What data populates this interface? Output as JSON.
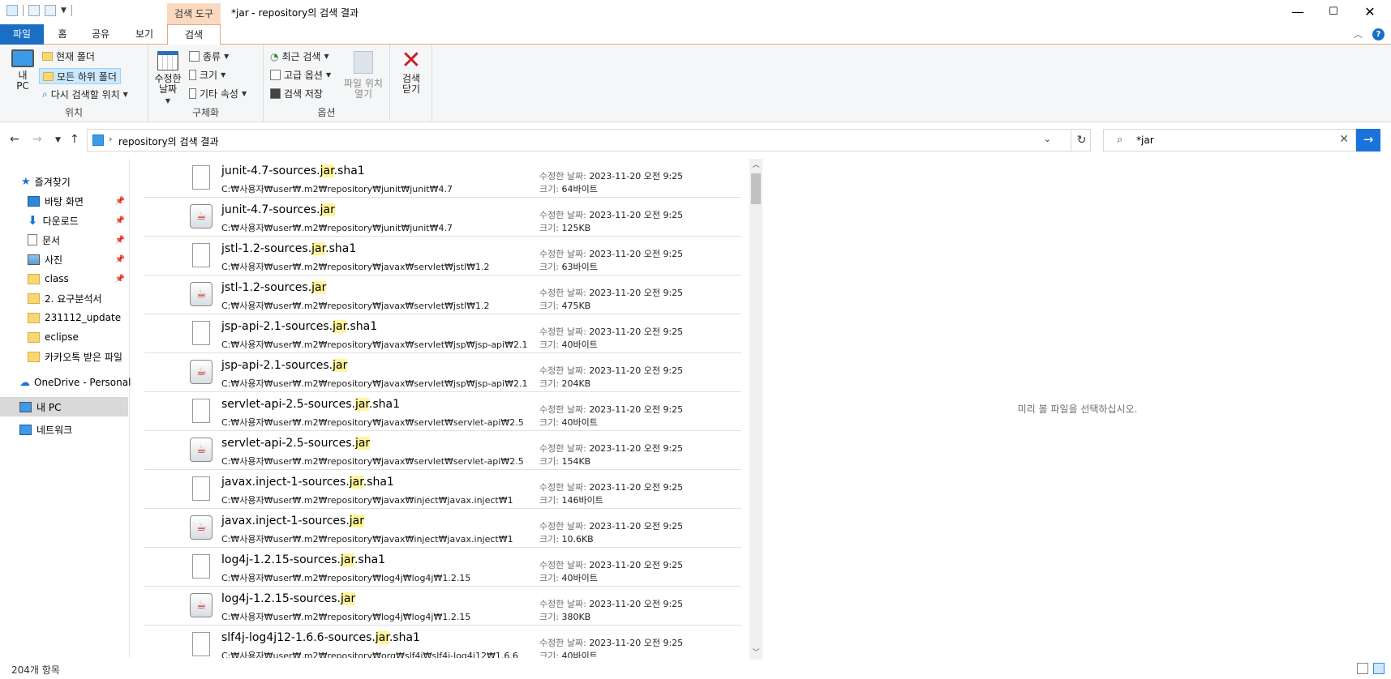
{
  "window": {
    "title": "*jar - repository의 검색 결과",
    "search_tools_tab": "검색 도구",
    "minimize": "—",
    "maximize": "☐",
    "close": "✕"
  },
  "ribbon": {
    "tabs": [
      "파일",
      "홈",
      "공유",
      "보기",
      "검색"
    ],
    "active_tab": "검색",
    "location_group": {
      "label": "위치",
      "this_pc": "내 PC",
      "current_folder": "현재 폴더",
      "all_subfolders": "모든 하위 폴더",
      "search_again": "다시 검색할 위치"
    },
    "refine_group": {
      "label": "구체화",
      "date_modified": "수정한 날짜",
      "kind": "종류",
      "size": "크기",
      "other_props": "기타 속성"
    },
    "options_group": {
      "label": "옵션",
      "recent_searches": "최근 검색",
      "advanced_options": "고급 옵션",
      "save_search": "검색 저장",
      "open_file_location": "파일 위치 열기"
    },
    "close_search": "검색 닫기"
  },
  "address": {
    "path": "repository의 검색 결과",
    "search_value": "*jar"
  },
  "nav": {
    "quick_access": "즐겨찾기",
    "items": [
      {
        "label": "바탕 화면",
        "pinned": true,
        "icon": "desktop-icon"
      },
      {
        "label": "다운로드",
        "pinned": true,
        "icon": "download-icon"
      },
      {
        "label": "문서",
        "pinned": true,
        "icon": "document-icon"
      },
      {
        "label": "사진",
        "pinned": true,
        "icon": "picture-icon"
      },
      {
        "label": "class",
        "pinned": true,
        "icon": "folder-icon"
      },
      {
        "label": "2. 요구분석서",
        "pinned": false,
        "icon": "folder-icon"
      },
      {
        "label": "231112_update",
        "pinned": false,
        "icon": "folder-icon"
      },
      {
        "label": "eclipse",
        "pinned": false,
        "icon": "folder-icon"
      },
      {
        "label": "카카오톡 받은 파일",
        "pinned": false,
        "icon": "folder-icon"
      }
    ],
    "onedrive": "OneDrive - Personal",
    "this_pc": "내 PC",
    "network": "네트워크"
  },
  "files": [
    {
      "pre": "junit-4.7-sources.",
      "hl": "jar",
      "post": ".sha1",
      "type": "doc",
      "path": "C:₩사용자₩user₩.m2₩repository₩junit₩junit₩4.7",
      "date": "2023-11-20 오전 9:25",
      "size": "64바이트"
    },
    {
      "pre": "junit-4.7-sources.",
      "hl": "jar",
      "post": "",
      "type": "java",
      "path": "C:₩사용자₩user₩.m2₩repository₩junit₩junit₩4.7",
      "date": "2023-11-20 오전 9:25",
      "size": "125KB"
    },
    {
      "pre": "jstl-1.2-sources.",
      "hl": "jar",
      "post": ".sha1",
      "type": "doc",
      "path": "C:₩사용자₩user₩.m2₩repository₩javax₩servlet₩jstl₩1.2",
      "date": "2023-11-20 오전 9:25",
      "size": "63바이트"
    },
    {
      "pre": "jstl-1.2-sources.",
      "hl": "jar",
      "post": "",
      "type": "java",
      "path": "C:₩사용자₩user₩.m2₩repository₩javax₩servlet₩jstl₩1.2",
      "date": "2023-11-20 오전 9:25",
      "size": "475KB"
    },
    {
      "pre": "jsp-api-2.1-sources.",
      "hl": "jar",
      "post": ".sha1",
      "type": "doc",
      "path": "C:₩사용자₩user₩.m2₩repository₩javax₩servlet₩jsp₩jsp-api₩2.1",
      "date": "2023-11-20 오전 9:25",
      "size": "40바이트"
    },
    {
      "pre": "jsp-api-2.1-sources.",
      "hl": "jar",
      "post": "",
      "type": "java",
      "path": "C:₩사용자₩user₩.m2₩repository₩javax₩servlet₩jsp₩jsp-api₩2.1",
      "date": "2023-11-20 오전 9:25",
      "size": "204KB"
    },
    {
      "pre": "servlet-api-2.5-sources.",
      "hl": "jar",
      "post": ".sha1",
      "type": "doc",
      "path": "C:₩사용자₩user₩.m2₩repository₩javax₩servlet₩servlet-api₩2.5",
      "date": "2023-11-20 오전 9:25",
      "size": "40바이트"
    },
    {
      "pre": "servlet-api-2.5-sources.",
      "hl": "jar",
      "post": "",
      "type": "java",
      "path": "C:₩사용자₩user₩.m2₩repository₩javax₩servlet₩servlet-api₩2.5",
      "date": "2023-11-20 오전 9:25",
      "size": "154KB"
    },
    {
      "pre": "javax.inject-1-sources.",
      "hl": "jar",
      "post": ".sha1",
      "type": "doc",
      "path": "C:₩사용자₩user₩.m2₩repository₩javax₩inject₩javax.inject₩1",
      "date": "2023-11-20 오전 9:25",
      "size": "146바이트"
    },
    {
      "pre": "javax.inject-1-sources.",
      "hl": "jar",
      "post": "",
      "type": "java",
      "path": "C:₩사용자₩user₩.m2₩repository₩javax₩inject₩javax.inject₩1",
      "date": "2023-11-20 오전 9:25",
      "size": "10.6KB"
    },
    {
      "pre": "log4j-1.2.15-sources.",
      "hl": "jar",
      "post": ".sha1",
      "type": "doc",
      "path": "C:₩사용자₩user₩.m2₩repository₩log4j₩log4j₩1.2.15",
      "date": "2023-11-20 오전 9:25",
      "size": "40바이트"
    },
    {
      "pre": "log4j-1.2.15-sources.",
      "hl": "jar",
      "post": "",
      "type": "java",
      "path": "C:₩사용자₩user₩.m2₩repository₩log4j₩log4j₩1.2.15",
      "date": "2023-11-20 오전 9:25",
      "size": "380KB"
    },
    {
      "pre": "slf4j-log4j12-1.6.6-sources.",
      "hl": "jar",
      "post": ".sha1",
      "type": "doc",
      "path": "C:₩사용자₩user₩.m2₩repository₩org₩slf4j₩slf4j-log4j12₩1.6.6",
      "date": "2023-11-20 오전 9:25",
      "size": "40바이트"
    }
  ],
  "labels": {
    "modified": "수정한 날짜:",
    "size": "크기:"
  },
  "preview_message": "미리 볼 파일을 선택하십시오.",
  "status": {
    "count": "204개 항목"
  }
}
